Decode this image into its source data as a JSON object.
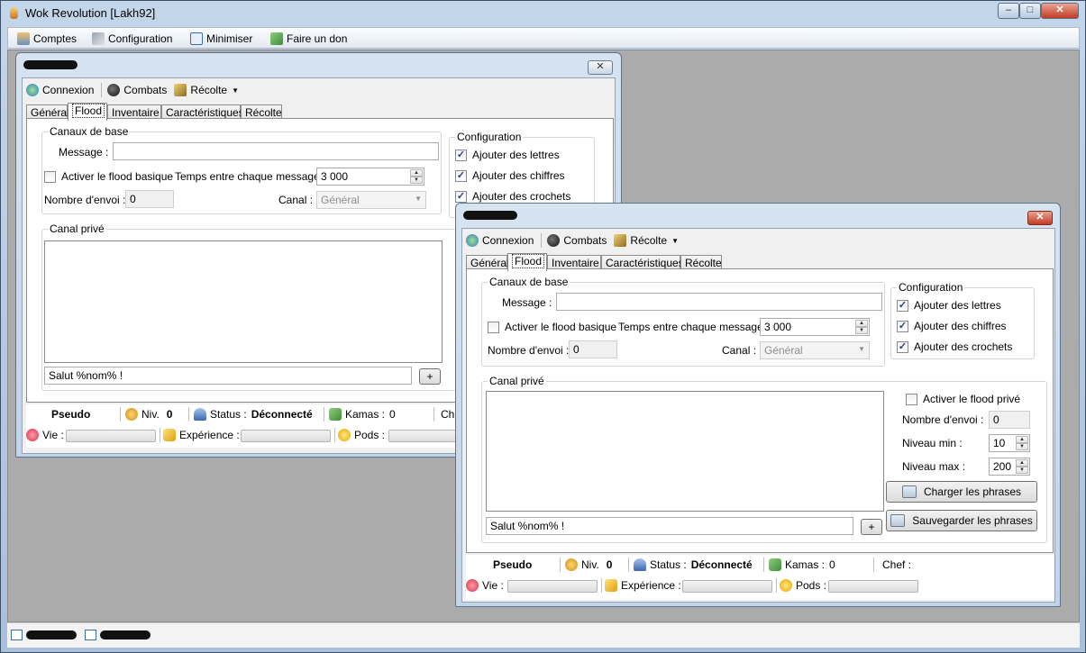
{
  "app": {
    "title": "Wok Revolution [Lakh92]",
    "menu": [
      "Comptes",
      "Configuration",
      "Minimiser",
      "Faire un don"
    ]
  },
  "toolbar": {
    "connexion": "Connexion",
    "combats": "Combats",
    "recolte": "Récolte"
  },
  "tabs": [
    "Général",
    "Flood",
    "Inventaire",
    "Caractéristiques",
    "Récolte"
  ],
  "flood": {
    "canaux_de_base": "Canaux de base",
    "message_label": "Message :",
    "activer_flood_basique": "Activer le flood basique",
    "temps_label": "Temps entre chaque message :",
    "temps_value": "3 000",
    "nombre_envoi_label": "Nombre d'envoi :",
    "nombre_envoi_value": "0",
    "canal_label": "Canal :",
    "canal_value": "Général",
    "configuration": "Configuration",
    "ajouter_lettres": "Ajouter des lettres",
    "ajouter_chiffres": "Ajouter des chiffres",
    "ajouter_crochets": "Ajouter des crochets",
    "canal_prive": "Canal privé",
    "prive_input": "Salut %nom% !",
    "plus": "+",
    "activer_flood_prive": "Activer le flood privé",
    "prive_nombre_envoi_value": "0",
    "niveau_min_label": "Niveau min :",
    "niveau_min_value": "10",
    "niveau_max_label": "Niveau max :",
    "niveau_max_value": "200",
    "charger": "Charger les phrases",
    "sauvegarder": "Sauvegarder les phrases"
  },
  "status": {
    "pseudo": "Pseudo",
    "niv_label": "Niv.",
    "niv_value": "0",
    "status_label": "Status :",
    "status_value": "Déconnecté",
    "kamas_label": "Kamas :",
    "kamas_value": "0",
    "chef_label": "Chef :",
    "chef_truncated": "Che",
    "vie_label": "Vie :",
    "experience_label": "Expérience :",
    "pods_label": "Pods :"
  },
  "colors": {
    "accent": "#2b3f86",
    "close_red": "#c23b22",
    "mdi_bg": "#ababab"
  }
}
